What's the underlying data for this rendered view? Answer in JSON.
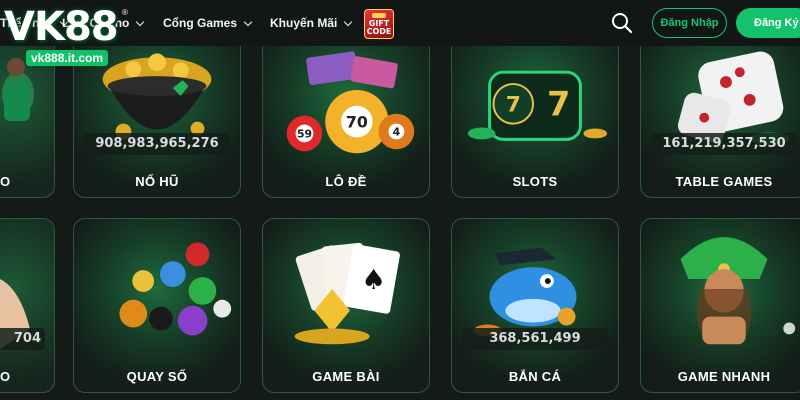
{
  "header": {
    "logo": {
      "mark": "VK88",
      "reg": "®",
      "domain": "vk888.it.com"
    },
    "nav": [
      {
        "label": "Thể Thao"
      },
      {
        "label": "Live Casino"
      },
      {
        "label": "Cổng Games"
      },
      {
        "label": "Khuyến Mãi"
      }
    ],
    "gift": {
      "line1": "GIFT",
      "line2": "CODE"
    },
    "login_label": "Đăng Nhập",
    "register_label": "Đăng Ký"
  },
  "games_row1": [
    {
      "label": "NỔ HŨ",
      "jackpot": "908,983,965,276",
      "icon": "pot-of-gold-icon"
    },
    {
      "label": "LÔ ĐỀ",
      "jackpot": "",
      "icon": "bingo-balls-icon"
    },
    {
      "label": "SLOTS",
      "jackpot": "",
      "icon": "slot-machine-icon"
    },
    {
      "label": "TABLE GAMES",
      "jackpot": "161,219,357,530",
      "icon": "dice-icon"
    }
  ],
  "games_row2": [
    {
      "label": "QUAY SỐ",
      "jackpot": "",
      "icon": "lottery-balls-icon"
    },
    {
      "label": "GAME BÀI",
      "jackpot": "",
      "icon": "playing-cards-icon"
    },
    {
      "label": "BẮN CÁ",
      "jackpot": "368,561,499",
      "icon": "fish-icon"
    },
    {
      "label": "GAME NHANH",
      "jackpot": "",
      "icon": "aztec-girl-icon"
    }
  ],
  "edge_left": {
    "row1_label": "O",
    "row2_jackpot": "704",
    "row2_label": "O"
  },
  "colors": {
    "accent": "#14c16c",
    "background": "#131a17",
    "card_border": "#2c5a3f"
  }
}
